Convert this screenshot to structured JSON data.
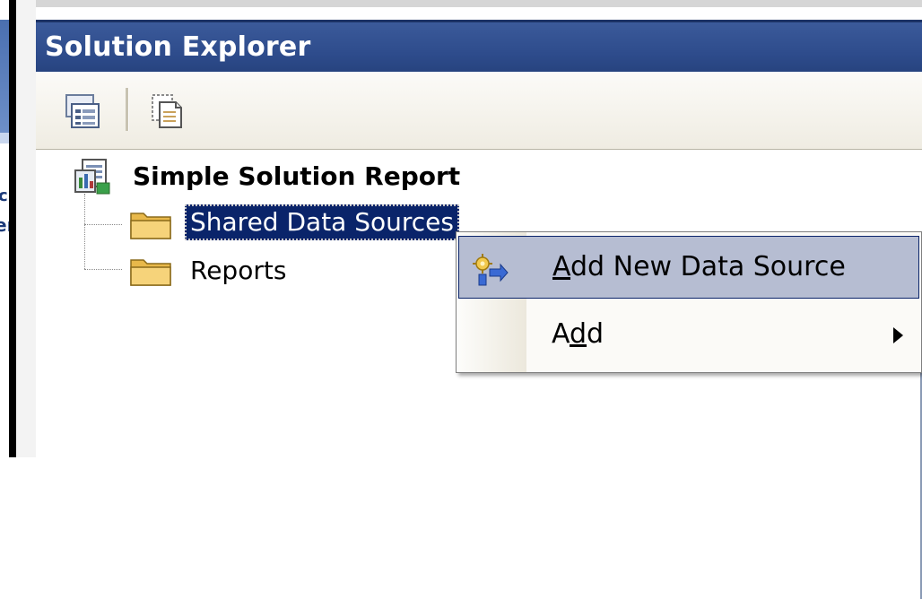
{
  "window": {
    "title": "Solution Explorer"
  },
  "toolbar": {
    "buttons": [
      {
        "icon": "properties-icon"
      },
      {
        "icon": "show-all-files-icon"
      }
    ]
  },
  "tree": {
    "root": {
      "label": "Simple Solution Report",
      "icon": "report-project-icon"
    },
    "nodes": [
      {
        "label": "Shared Data Sources",
        "icon": "folder-icon",
        "selected": true
      },
      {
        "label": "Reports",
        "icon": "folder-icon",
        "selected": false
      }
    ]
  },
  "context_menu": {
    "items": [
      {
        "label": "Add New Data Source",
        "mnemonic": "A",
        "rest": "dd New Data Source",
        "icon": "add-data-source-icon",
        "highlighted": true
      },
      {
        "label": "Add",
        "mnemonic_prefix": "A",
        "mnemonic": "d",
        "rest": "d",
        "has_submenu": true
      }
    ]
  },
  "background_fragments": {
    "frag1": "c",
    "frag2": "er"
  }
}
